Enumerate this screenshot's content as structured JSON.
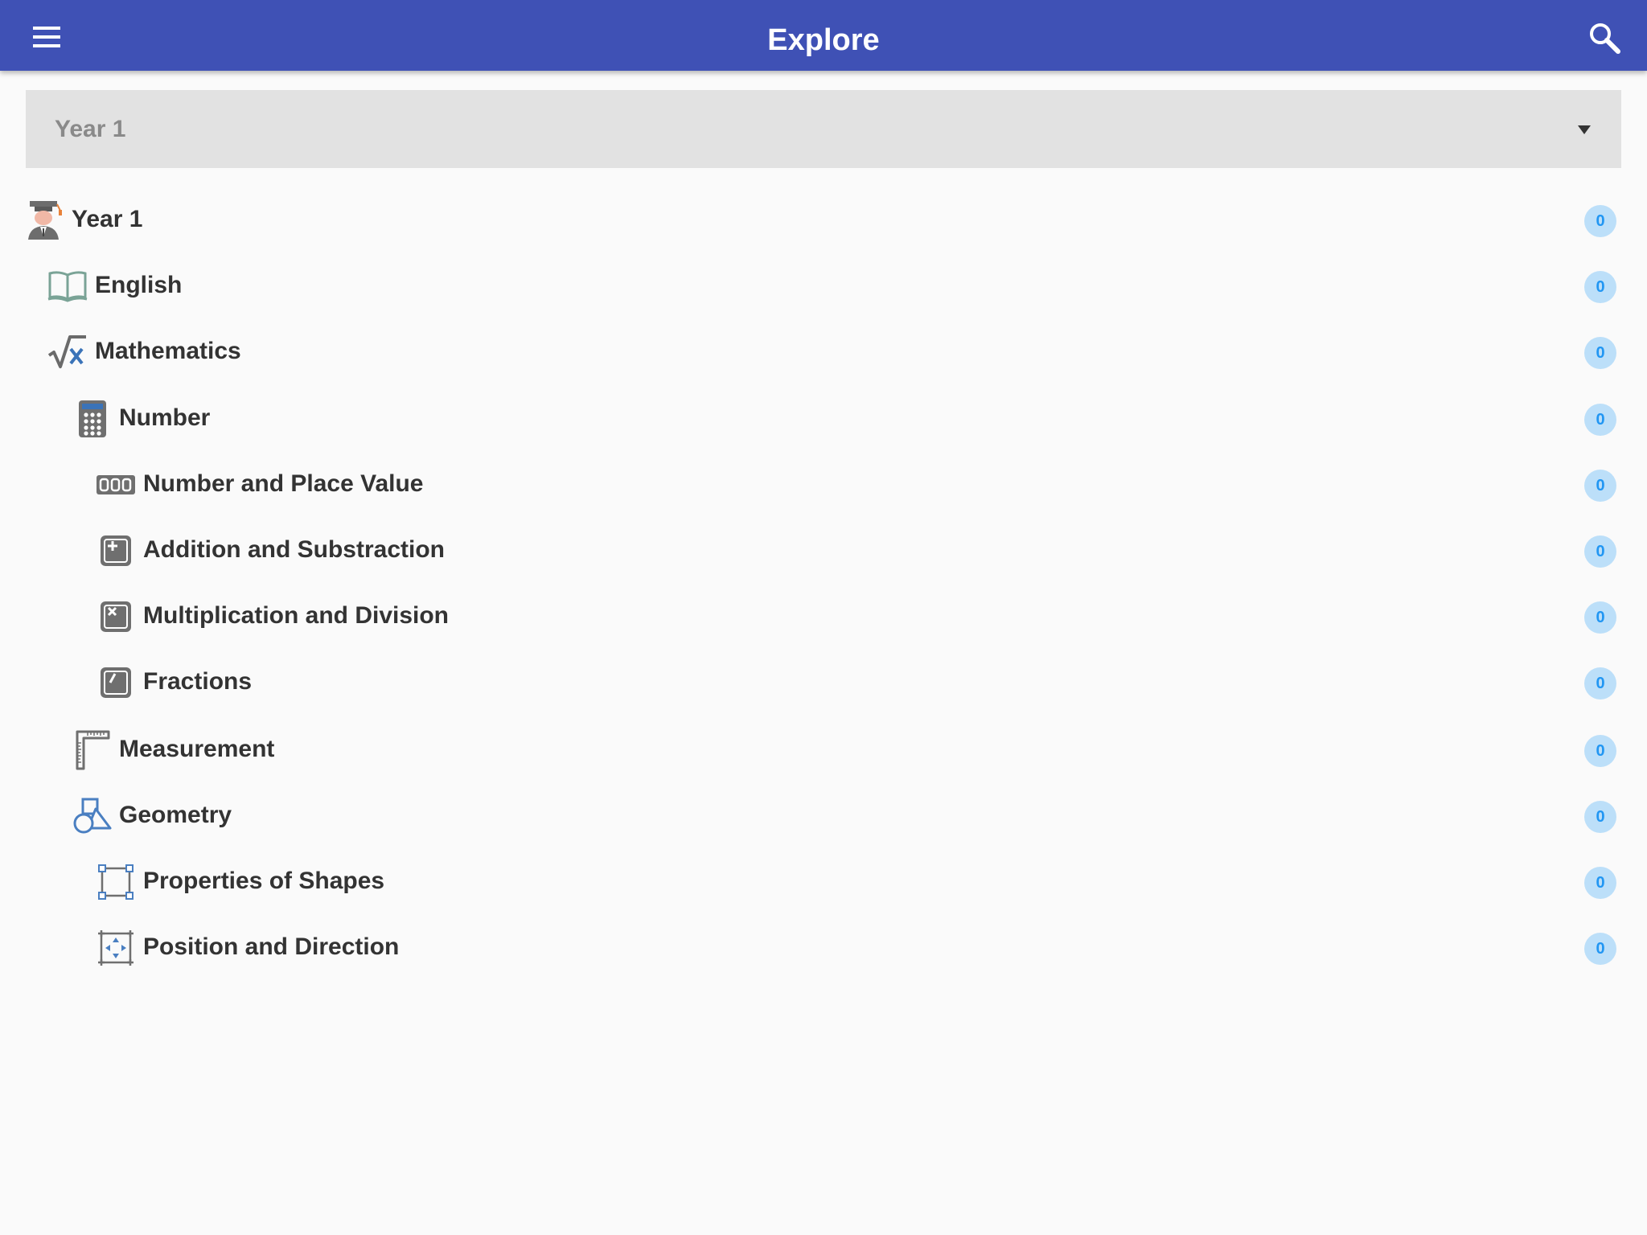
{
  "appbar": {
    "title": "Explore",
    "menu_icon": "hamburger-menu-icon",
    "search_icon": "search-icon",
    "color": "#3f51b5"
  },
  "year_select": {
    "value": "Year 1"
  },
  "tree": [
    {
      "label": "Year 1",
      "icon": "graduate-icon",
      "count": "0",
      "level": 0
    },
    {
      "label": "English",
      "icon": "open-book-icon",
      "count": "0",
      "level": 1
    },
    {
      "label": "Mathematics",
      "icon": "square-root-x-icon",
      "count": "0",
      "level": 1
    },
    {
      "label": "Number",
      "icon": "calculator-icon",
      "count": "0",
      "level": 2
    },
    {
      "label": "Number and Place Value",
      "icon": "place-value-digits-icon",
      "count": "0",
      "level": 3
    },
    {
      "label": "Addition and Substraction",
      "icon": "plus-key-icon",
      "count": "0",
      "level": 3
    },
    {
      "label": "Multiplication and Division",
      "icon": "times-key-icon",
      "count": "0",
      "level": 3
    },
    {
      "label": "Fractions",
      "icon": "slash-key-icon",
      "count": "0",
      "level": 3
    },
    {
      "label": "Measurement",
      "icon": "ruler-square-icon",
      "count": "0",
      "level": 2
    },
    {
      "label": "Geometry",
      "icon": "shapes-icon",
      "count": "0",
      "level": 2
    },
    {
      "label": "Properties of Shapes",
      "icon": "selection-square-icon",
      "count": "0",
      "level": 3
    },
    {
      "label": "Position and Direction",
      "icon": "move-arrows-icon",
      "count": "0",
      "level": 3
    }
  ],
  "badge_color": "#bcdff9"
}
